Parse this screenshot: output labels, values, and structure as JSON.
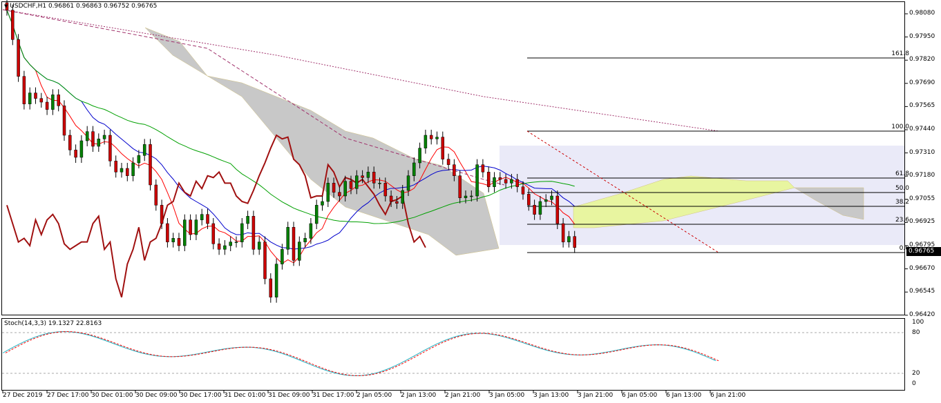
{
  "header": {
    "symbol_info": "USDCHF,H1  0.96861 0.96863 0.96752 0.96765"
  },
  "indicator": {
    "label": "Stoch(14,3,3) 19.1327 22.8163"
  },
  "price_axis": [
    "0.98080",
    "0.97950",
    "0.97820",
    "0.97690",
    "0.97565",
    "0.97440",
    "0.97310",
    "0.97180",
    "0.97055",
    "0.96925",
    "0.96795",
    "0.96670",
    "0.96545",
    "0.96420"
  ],
  "current_price": "0.96765",
  "stoch_axis": [
    "100",
    "80",
    "20",
    "0"
  ],
  "time_axis": [
    "27 Dec 2019",
    "27 Dec 17:00",
    "30 Dec 01:00",
    "30 Dec 09:00",
    "30 Dec 17:00",
    "31 Dec 01:00",
    "31 Dec 09:00",
    "31 Dec 17:00",
    "2 Jan 05:00",
    "2 Jan 13:00",
    "2 Jan 21:00",
    "3 Jan 05:00",
    "3 Jan 13:00",
    "3 Jan 21:00",
    "6 Jan 05:00",
    "6 Jan 13:00",
    "6 Jan 21:00"
  ],
  "fibonacci": [
    "161.8",
    "100.0",
    "61.8",
    "50.0",
    "38.2",
    "23.6",
    "0.0"
  ],
  "colors": {
    "bull": "#008000",
    "bear": "#cc0000",
    "cloud": "#c8c8c8",
    "cloud_bull": "#e8f5a0",
    "box": "#e8e8f8",
    "ma_fast": "#ff0000",
    "ma_slow": "#00a000",
    "kijun": "#0000cc",
    "chikou": "#a01010",
    "long_ma": "#a0306a",
    "stoch_main": "#20b0c0",
    "stoch_signal": "#ff0000"
  },
  "chart_data": {
    "type": "candlestick",
    "symbol": "USDCHF",
    "timeframe": "H1",
    "ylim": [
      0.9642,
      0.981
    ],
    "close": [
      0.9806,
      0.979,
      0.977,
      0.9755,
      0.9761,
      0.9758,
      0.9756,
      0.9752,
      0.976,
      0.9754,
      0.9738,
      0.973,
      0.9726,
      0.9735,
      0.974,
      0.9732,
      0.9736,
      0.9738,
      0.9724,
      0.9718,
      0.972,
      0.9716,
      0.9723,
      0.9727,
      0.9733,
      0.9711,
      0.97,
      0.969,
      0.968,
      0.9682,
      0.9678,
      0.9692,
      0.9684,
      0.9692,
      0.9695,
      0.969,
      0.9679,
      0.9676,
      0.9678,
      0.968,
      0.968,
      0.969,
      0.9694,
      0.9676,
      0.968,
      0.966,
      0.965,
      0.9668,
      0.9676,
      0.9688,
      0.967,
      0.968,
      0.9682,
      0.969,
      0.97,
      0.9702,
      0.9712,
      0.9707,
      0.9705,
      0.9713,
      0.9709,
      0.9716,
      0.9715,
      0.9718,
      0.9712,
      0.9712,
      0.9705,
      0.9702,
      0.9701,
      0.9708,
      0.9716,
      0.9723,
      0.9731,
      0.9738,
      0.9736,
      0.9737,
      0.9725,
      0.9722,
      0.9716,
      0.9704,
      0.9705,
      0.9705,
      0.9722,
      0.9718,
      0.971,
      0.9715,
      0.9714,
      0.9712,
      0.9714,
      0.971,
      0.9706,
      0.97,
      0.9695,
      0.9702,
      0.9703,
      0.9705,
      0.969,
      0.968,
      0.9683,
      0.9677
    ]
  }
}
